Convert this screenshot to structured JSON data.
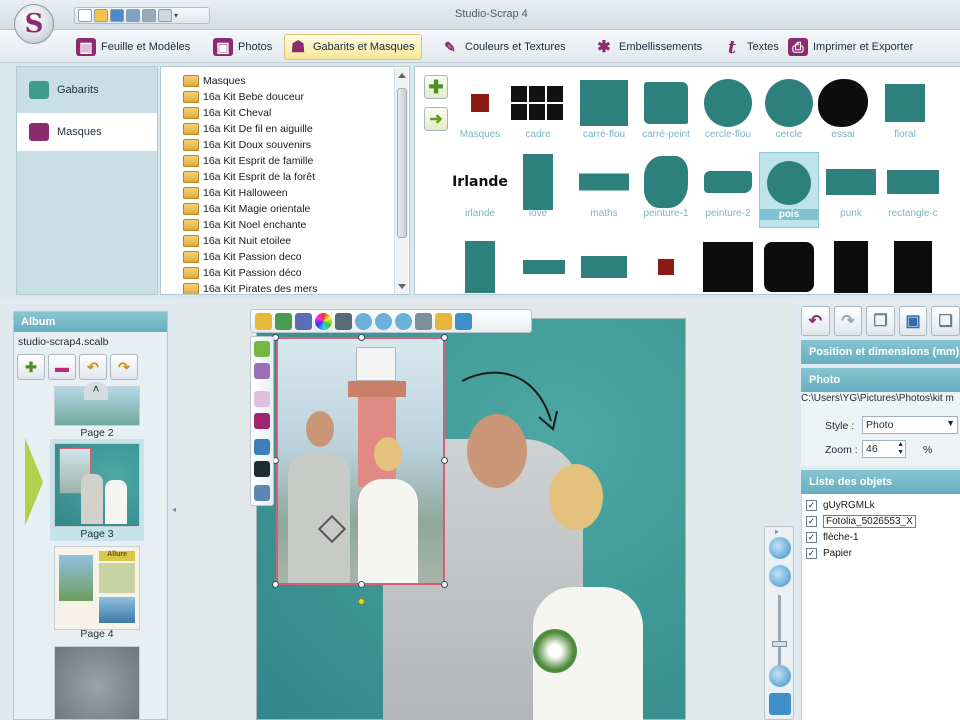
{
  "window": {
    "title": "Studio-Scrap 4",
    "logo_letter": "S"
  },
  "ribbon": {
    "tabs": [
      {
        "label": "Feuille et Modèles",
        "icon": "sheet-icon"
      },
      {
        "label": "Photos",
        "icon": "photos-icon"
      },
      {
        "label": "Gabarits et Masques",
        "icon": "templates-icon"
      },
      {
        "label": "Couleurs et Textures",
        "icon": "brush-icon"
      },
      {
        "label": "Embellissements",
        "icon": "embellishment-star-icon"
      },
      {
        "label": "Textes",
        "icon": "text-t-icon"
      },
      {
        "label": "Imprimer et Exporter",
        "icon": "printer-icon"
      }
    ],
    "active_tab": "Gabarits et Masques"
  },
  "templates": {
    "nav": [
      {
        "label": "Gabarits",
        "icon": "gabarits-icon"
      },
      {
        "label": "Masques",
        "icon": "masks-icon"
      }
    ],
    "tree": [
      "Masques",
      "16a Kit Bebe douceur",
      "16a Kit Cheval",
      "16a Kit De fil en aiguille",
      "16a Kit Doux souvenirs",
      "16a Kit Esprit de famille",
      "16a Kit Esprit de la forêt",
      "16a Kit Halloween",
      "16a Kit Magie orientale",
      "16a Kit Noel enchante",
      "16a Kit Nuit etoilee",
      "16a Kit Passion deco",
      "16a Kit Passion déco",
      "16a Kit Pirates des mers"
    ],
    "masks": [
      "Masques",
      "cadre",
      "carré-flou",
      "carré-peint",
      "cercle-flou",
      "cercle",
      "essai",
      "floral",
      "irlande",
      "love",
      "maths",
      "peinture-1",
      "peinture-2",
      "pois",
      "punk",
      "rectangle-c"
    ],
    "irlande_text": "Irlande",
    "selected_mask": "pois"
  },
  "album": {
    "title": "Album",
    "file": "studio-scrap4.scalb",
    "pages": [
      "Page 2",
      "Page 3",
      "Page 4"
    ],
    "page4_banner": "Allure"
  },
  "properties": {
    "position_header": "Position et dimensions (mm)",
    "photo_header": "Photo",
    "photo_path": "C:\\Users\\YG\\Pictures\\Photos\\kit m",
    "style_label": "Style :",
    "style_value": "Photo",
    "zoom_label": "Zoom :",
    "zoom_value": "46",
    "zoom_unit": "%",
    "objects_header": "Liste des objets",
    "objects": [
      {
        "name": "gUyRGMLk",
        "checked": true
      },
      {
        "name": "Fotolia_5026553_X",
        "checked": true
      },
      {
        "name": "flèche-1",
        "checked": true
      },
      {
        "name": "Papier",
        "checked": true
      }
    ]
  },
  "colors": {
    "teal_bg": "#3b9592",
    "header_teal": "#66afbf",
    "active_tab": "#f6e79b",
    "plum_accent": "#8a2a6f"
  }
}
